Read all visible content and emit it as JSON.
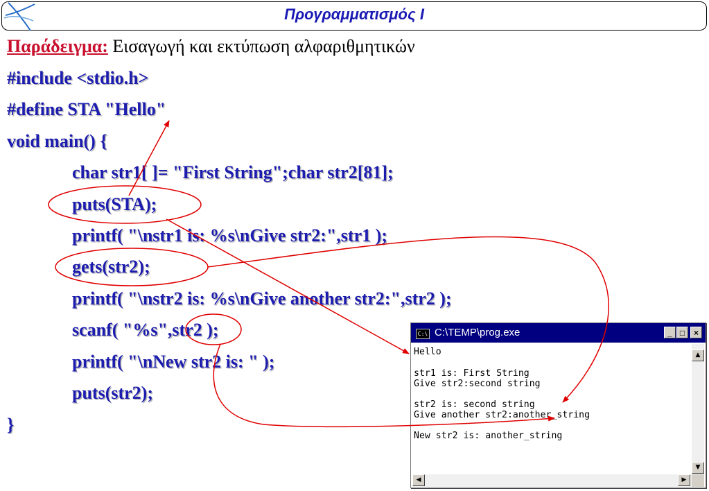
{
  "header": {
    "title": "Προγραμματισμός Ι"
  },
  "heading": {
    "label": "Παράδειγμα:",
    "text": " Εισαγωγή και εκτύπωση αλφαριθμητικών"
  },
  "code": {
    "line1": "#include <stdio.h>",
    "line2": "#define STA \"Hello\"",
    "line3": "void main()  {",
    "line4": "char str1[ ]= \"First String\";char str2[81];",
    "line5": "puts(STA);",
    "line6": "printf( \"\\nstr1 is: %s\\nGive str2:\",str1 );",
    "line7": "gets(str2);",
    "line8": "printf( \"\\nstr2 is: %s\\nGive another str2:\",str2 );",
    "line9": "scanf( \"%s\",str2 );",
    "line10": "printf( \"\\nNew str2 is: \" );",
    "line11": "puts(str2);",
    "line12": "}"
  },
  "console": {
    "title": "C:\\TEMP\\prog.exe",
    "icon": "C:\\",
    "minimize": "_",
    "maximize": "□",
    "close": "×",
    "lines": [
      "Hello",
      "str1 is: First String",
      "Give str2:second string",
      "str2 is: second string",
      "Give another str2:another_string",
      "New str2 is: another_string"
    ]
  },
  "colors": {
    "code": "#1c1caf",
    "label": "#c8102e",
    "annotation": "#e00000",
    "titlebar": "#000080"
  }
}
